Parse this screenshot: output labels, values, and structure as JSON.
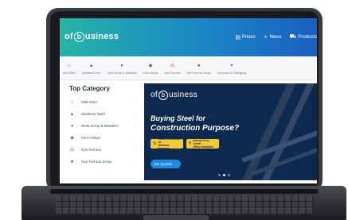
{
  "header": {
    "logo_prefix": "of",
    "logo_p": "b",
    "logo_suffix": "usiness",
    "links": [
      {
        "icon": "price-icon",
        "glyph": "▤",
        "label": "Prices"
      },
      {
        "icon": "news-icon",
        "glyph": "✧",
        "label": "News"
      },
      {
        "icon": "cart-icon",
        "glyph": "⛟",
        "label": "Products"
      }
    ]
  },
  "category_strip": [
    {
      "icon": "mild-steel-icon",
      "glyph": "⌂",
      "label": "Mild Steel"
    },
    {
      "icon": "stainless-steel-icon",
      "glyph": "▲",
      "label": "Stainless Steel"
    },
    {
      "icon": "steel-scrap-icon",
      "glyph": "●",
      "label": "Steel Scrap & Metallics"
    },
    {
      "icon": "ferro-alloys-icon",
      "glyph": "◆",
      "label": "Ferro Alloys"
    },
    {
      "icon": "non-ferrous-icon",
      "glyph": "⁂",
      "label": "Non Ferrous"
    },
    {
      "icon": "non-ferrous-scrap-icon",
      "glyph": "●",
      "label": "Non Ferrous Scrap"
    },
    {
      "icon": "polymers-icon",
      "glyph": "✦",
      "label": "Polymers & Packaging"
    }
  ],
  "top_category": {
    "title": "Top Category",
    "items": [
      {
        "icon": "mild-steel-icon",
        "glyph": "⌂",
        "label": "Mild Steel"
      },
      {
        "icon": "stainless-steel-icon",
        "glyph": "▲",
        "label": "Stainless Steel"
      },
      {
        "icon": "steel-scrap-icon",
        "glyph": "●",
        "label": "Steel Scrap & Metallics"
      },
      {
        "icon": "ferro-alloys-icon",
        "glyph": "◆",
        "label": "Ferro Alloys"
      },
      {
        "icon": "non-ferrous-icon",
        "glyph": "⁂",
        "label": "Non Ferrous"
      },
      {
        "icon": "non-ferrous-scrap-icon",
        "glyph": "●",
        "label": "Non Ferrous Scrap"
      }
    ],
    "chevron": "›"
  },
  "banner": {
    "logo_prefix": "of",
    "logo_p": "b",
    "logo_suffix": "usiness",
    "heading_line1": "Buying Steel for",
    "heading_line2": "Construction Purpose?",
    "offers": [
      {
        "line1": "Instant Discounts on",
        "line2": "Advance Payment"
      },
      {
        "line1": "Interest Free Credit",
        "line2": "Offers Available"
      }
    ],
    "cta_label": "Get Quotes",
    "cta_arrow": "→"
  },
  "colors": {
    "header_start": "#25b3a7",
    "header_end": "#1a5fc0",
    "banner_bg": "#0d2a4e",
    "offer_tag": "#f4c93a",
    "cta": "#1e88e5"
  }
}
